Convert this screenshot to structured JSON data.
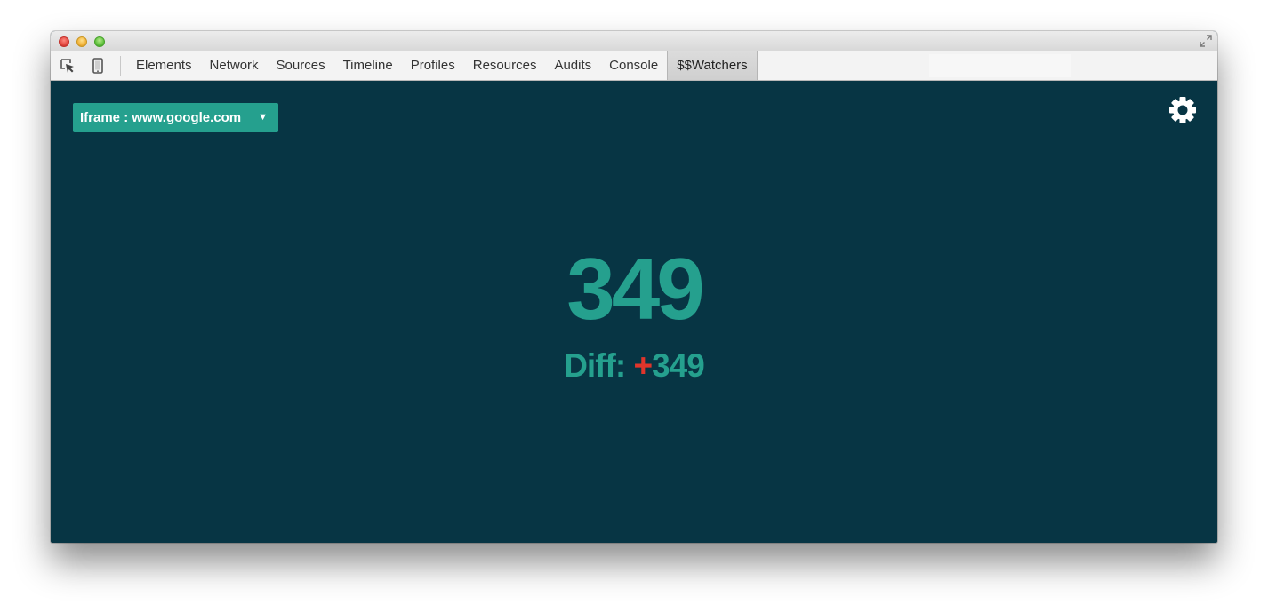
{
  "window": {
    "controls": [
      "close",
      "minimize",
      "maximize"
    ]
  },
  "toolbar": {
    "icons": [
      "inspect-element-icon",
      "device-mode-icon"
    ],
    "tabs": [
      {
        "label": "Elements",
        "active": false
      },
      {
        "label": "Network",
        "active": false
      },
      {
        "label": "Sources",
        "active": false
      },
      {
        "label": "Timeline",
        "active": false
      },
      {
        "label": "Profiles",
        "active": false
      },
      {
        "label": "Resources",
        "active": false
      },
      {
        "label": "Audits",
        "active": false
      },
      {
        "label": "Console",
        "active": false
      },
      {
        "label": "$$Watchers",
        "active": true
      }
    ]
  },
  "panel": {
    "frame_select": {
      "value": "Iframe : www.google.com",
      "arrow": "▼"
    },
    "settings_icon": "gear-icon",
    "watchers_count": "349",
    "diff_label": "Diff:",
    "diff_sign": "+",
    "diff_value": "349"
  },
  "colors": {
    "background": "#073544",
    "accent": "#25a08e",
    "diff_sign": "#e0352b",
    "toolbar": "#f3f3f3"
  }
}
